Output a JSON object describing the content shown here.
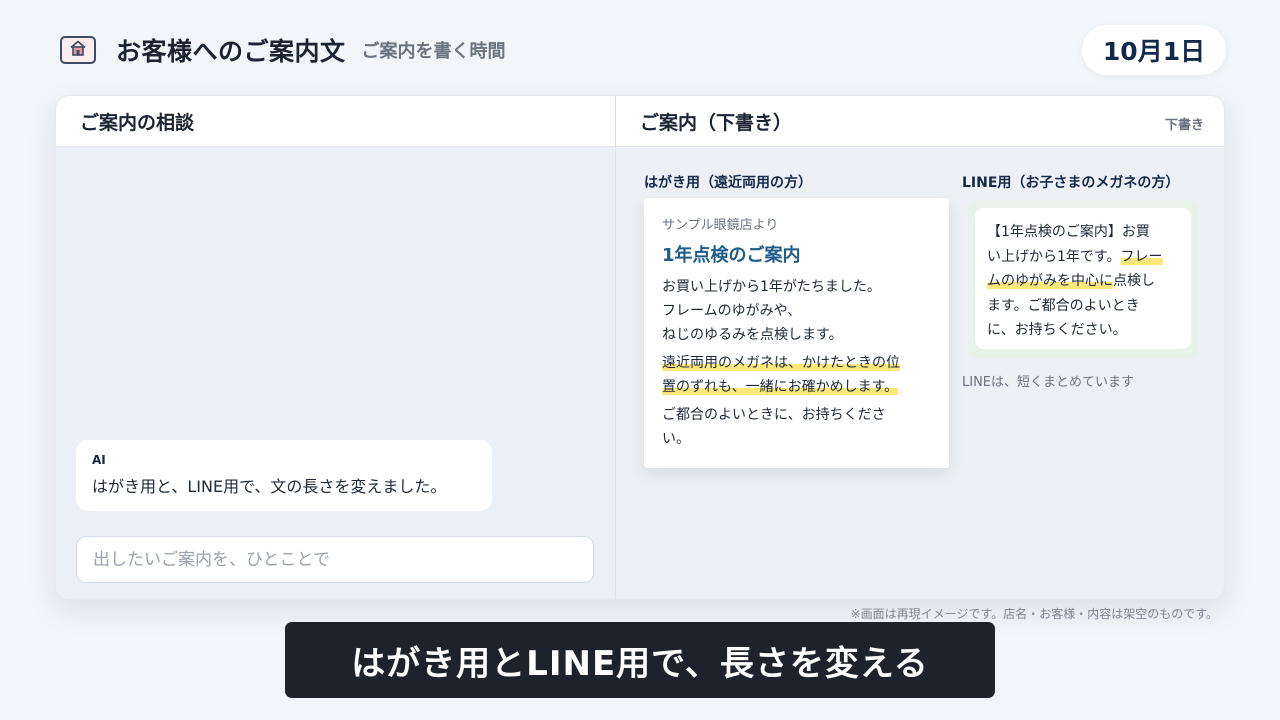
{
  "colors": {
    "brand_navy": "#13294b",
    "heading_blue": "#1d5d8a",
    "highlight_yellow": "#fbe77a",
    "caption_bg": "#1e232b"
  },
  "header": {
    "home_icon": "home-icon",
    "title": "お客様へのご案内文",
    "subtitle": "ご案内を書く時間",
    "date": "10月1日"
  },
  "left_pane": {
    "title": "ご案内の相談",
    "ai_message": {
      "sender": "AI",
      "text": "はがき用と、LINE用で、文の長さを変えました。"
    },
    "input": {
      "placeholder": "出したいご案内を、ひとことで",
      "value": ""
    }
  },
  "right_pane": {
    "title": "ご案内（下書き）",
    "status_tag": "下書き",
    "postcard": {
      "label": "はがき用（遠近両用の方）",
      "from": "サンプル眼鏡店より",
      "heading": "1年点検のご案内",
      "body_lines": [
        "お買い上げから1年がたちました。",
        "フレームのゆがみや、",
        "ねじのゆるみを点検します。"
      ],
      "highlight_lines": [
        "遠近両用のメガネは、かけたときの位",
        "置のずれも、一緒にお確かめします。"
      ],
      "closing_lines": [
        "ご都合のよいときに、お持ちくださ",
        "い。"
      ]
    },
    "line": {
      "label": "LINE用（お子さまのメガネの方）",
      "segments": {
        "a": "【1年点検のご案内】お買",
        "b": "い上げから1年です。",
        "c": "フレー",
        "d": "ムのゆがみを中心に",
        "e": "点検し",
        "f": "ます。ご都合のよいとき",
        "g": "に、お持ちください。"
      },
      "note": "LINEは、短くまとめています"
    }
  },
  "disclaimer": "※画面は再現イメージです。店名・お客様・内容は架空のものです。",
  "caption": "はがき用とLINE用で、長さを変える"
}
